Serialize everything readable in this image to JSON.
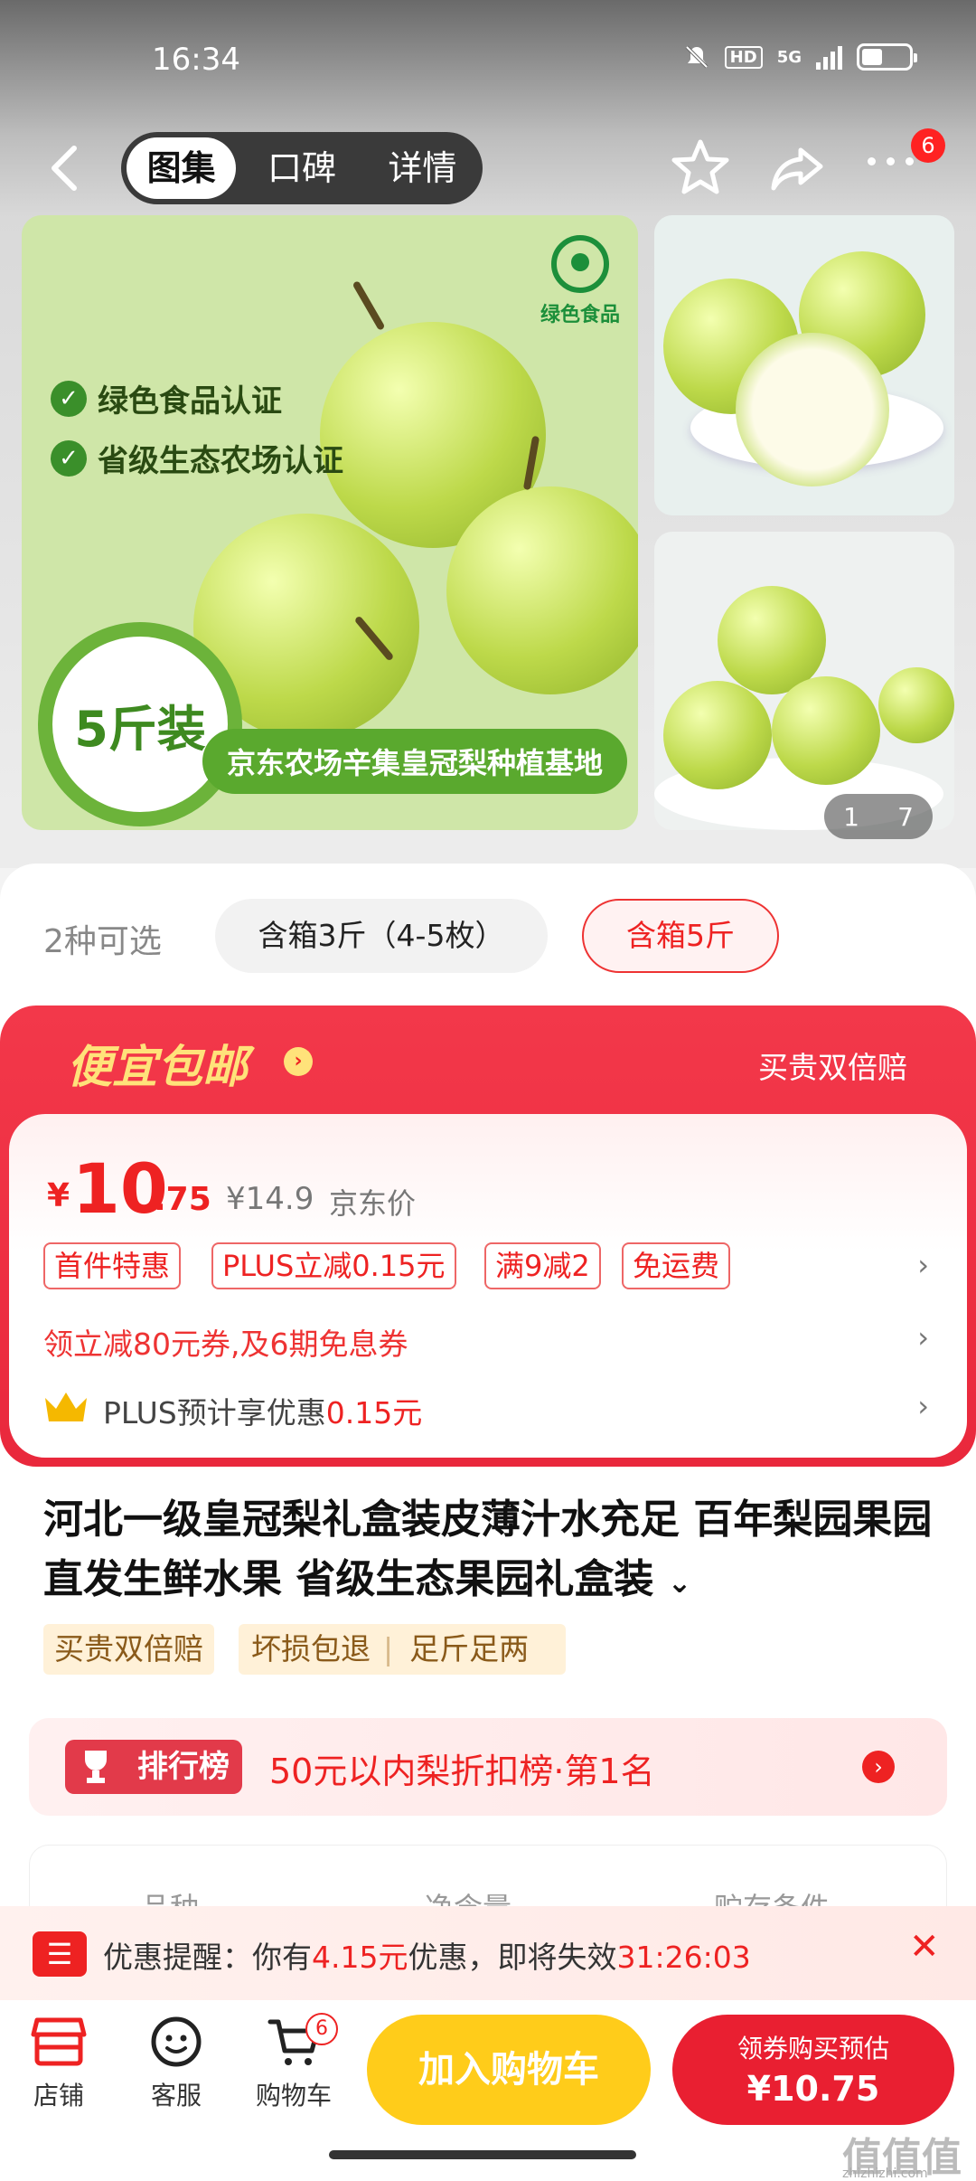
{
  "status": {
    "time": "16:34",
    "hd": "HD",
    "net": "5G"
  },
  "nav": {
    "tabs": [
      "图集",
      "口碑",
      "详情"
    ],
    "more_badge": "6"
  },
  "gallery": {
    "cert1": "绿色食品认证",
    "cert2": "省级生态农场认证",
    "logo_text": "绿色食品",
    "pack": "5斤装",
    "banner": "京东农场辛集皇冠梨种植基地",
    "counter_current": "1",
    "counter_total": "7"
  },
  "options": {
    "label": "2种可选",
    "items": [
      "含箱3斤（4-5枚）",
      "含箱5斤"
    ],
    "selected": 1
  },
  "promo": {
    "title": "便宜包邮",
    "right": "买贵双倍赔",
    "currency": "¥",
    "price_int": "10",
    "price_dec": ".75",
    "jd_price": "¥14.9",
    "jd_label": "京东价",
    "tags": [
      "首件特惠",
      "PLUS立减0.15元",
      "满9减2",
      "免运费"
    ],
    "coupon": "领立减80元券,及6期免息券",
    "plus_prefix": "PLUS预计享优惠",
    "plus_value": "0.15元"
  },
  "product": {
    "title": "河北一级皇冠梨礼盒装皮薄汁水充足 百年梨园果园直发生鲜水果 省级生态果园礼盒装",
    "tags": [
      "买贵双倍赔",
      "坏损包退",
      "足斤足两"
    ]
  },
  "rank": {
    "badge": "排行榜",
    "text": "50元以内梨折扣榜·第1名"
  },
  "specs": [
    "品种",
    "净含量",
    "贮存条件"
  ],
  "reminder": {
    "prefix": "优惠提醒：你有",
    "amount": "4.15元",
    "middle": "优惠，即将失效",
    "countdown": "31:26:03"
  },
  "bottom": {
    "shop": "店铺",
    "service": "客服",
    "cart": "购物车",
    "cart_count": "6",
    "add_cart": "加入购物车",
    "buy_top": "领券购买预估",
    "buy_price": "¥10.75"
  },
  "watermark": {
    "main": "值值值",
    "sub": "zhizhizhi.com"
  }
}
